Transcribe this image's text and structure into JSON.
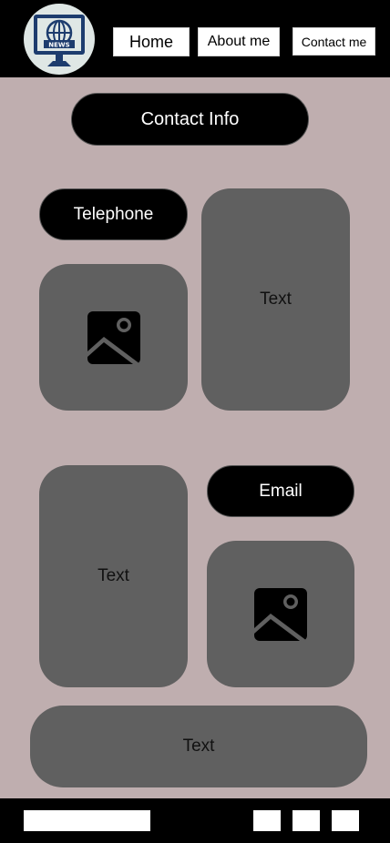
{
  "header": {
    "logo_icon": "globe-monitor-logo",
    "logo_text": "NEWS",
    "nav": {
      "home_label": "Home",
      "about_label": "About me",
      "contact_label": "Contact me"
    }
  },
  "main": {
    "contact_info_label": "Contact Info",
    "telephone_label": "Telephone",
    "email_label": "Email",
    "card_text_1": "Text",
    "card_text_2": "Text",
    "card_text_3": "Text",
    "image_icon": "image-placeholder-icon"
  },
  "colors": {
    "background": "#bfaeaf",
    "bar": "#000000",
    "card": "#606060",
    "pill": "#000000"
  }
}
